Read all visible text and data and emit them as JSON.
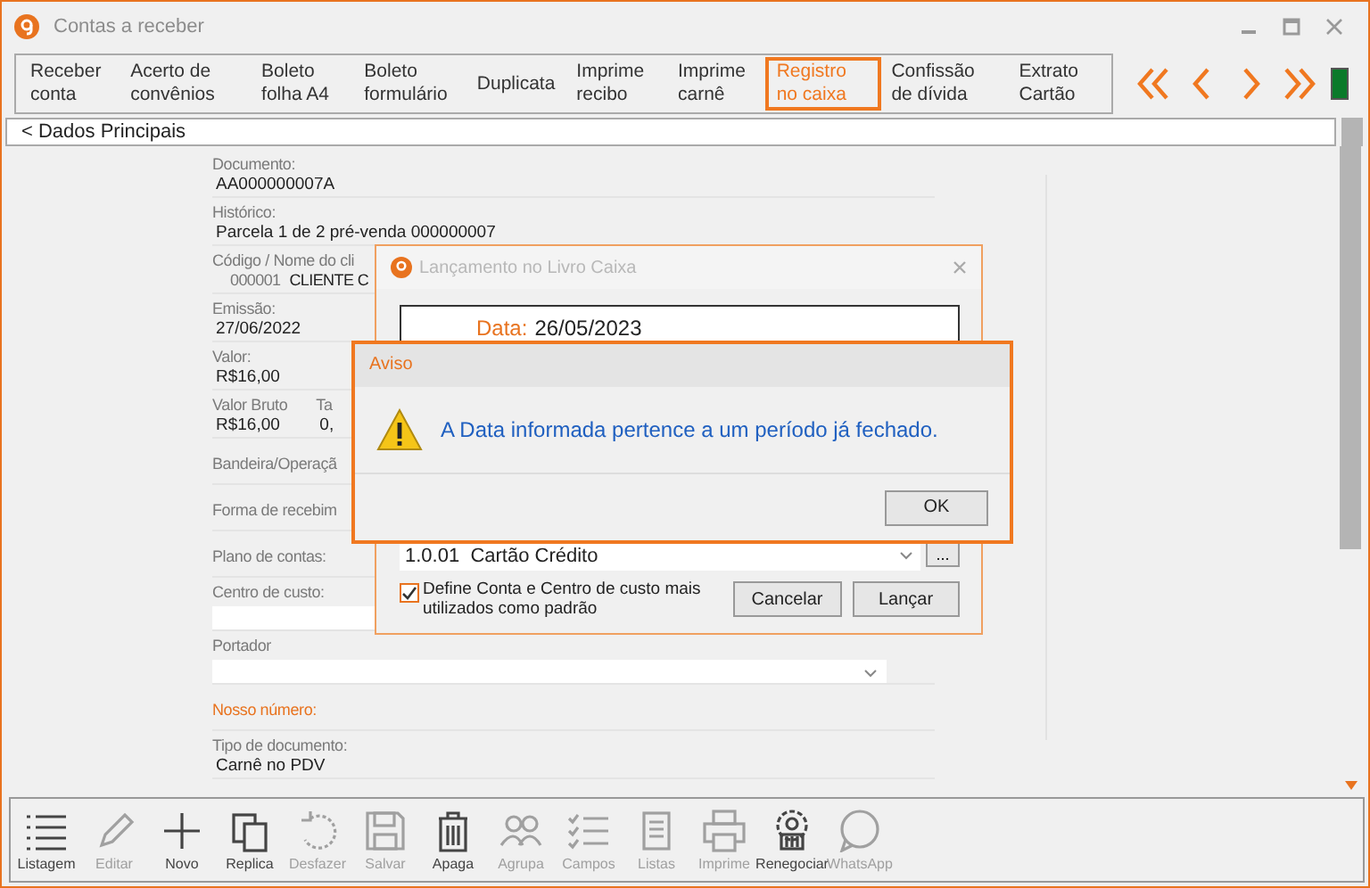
{
  "window": {
    "title": "Contas a receber"
  },
  "tabs": [
    {
      "label": "Receber conta",
      "selected": false
    },
    {
      "label": "Acerto de convênios",
      "selected": false
    },
    {
      "label": "Boleto folha A4",
      "selected": false
    },
    {
      "label": "Boleto formulário",
      "selected": false
    },
    {
      "label": "Duplicata",
      "selected": false
    },
    {
      "label": "Imprime recibo",
      "selected": false
    },
    {
      "label": "Imprime carnê",
      "selected": false
    },
    {
      "label": "Registro no caixa",
      "selected": true
    },
    {
      "label": "Confissão de dívida",
      "selected": false
    },
    {
      "label": "Extrato Cartão",
      "selected": false
    }
  ],
  "breadcrumb": "< Dados Principais",
  "fields": [
    {
      "kind": "text",
      "label": "Documento:",
      "value": "AA000000007A"
    },
    {
      "kind": "text",
      "label": "Histórico:",
      "value": "Parcela 1 de 2 pré-venda 000000007"
    },
    {
      "kind": "client",
      "label": "Código / Nome do cli",
      "code": "000001",
      "name": "CLIENTE C"
    },
    {
      "kind": "text",
      "label": "Emissão:",
      "value": "27/06/2022"
    },
    {
      "kind": "text",
      "label": "Valor:",
      "value": "R$16,00"
    },
    {
      "kind": "pair",
      "label": "Valor Bruto",
      "value": "R$16,00",
      "label_2": "Ta",
      "value_2": "0,"
    },
    {
      "kind": "label",
      "label": "Bandeira/Operaçã",
      "highlight": false
    },
    {
      "kind": "label",
      "label": "Forma de recebim",
      "highlight": false
    },
    {
      "kind": "label",
      "label": "Plano de contas:",
      "highlight": false
    },
    {
      "kind": "select",
      "label": "Centro de custo:"
    },
    {
      "kind": "select",
      "label": "Portador"
    },
    {
      "kind": "label",
      "label": "Nosso número:",
      "highlight": true
    },
    {
      "kind": "text",
      "label": "Tipo de documento:",
      "value": "Carnê no PDV"
    }
  ],
  "cash_dialog": {
    "title": "Lançamento no Livro Caixa",
    "date_label": "Data:",
    "date_value": "26/05/2023",
    "account": "1.0.01  Cartão Crédito",
    "browse_button": "...",
    "default_checkbox": {
      "label": "Define Conta e Centro de custo mais utilizados como padrão",
      "checked": true
    },
    "buttons": [
      "Cancelar",
      "Lançar"
    ]
  },
  "alert": {
    "title": "Aviso",
    "message": "A Data informada pertence a um período já fechado.",
    "button": "OK"
  },
  "toolbar": [
    {
      "kind": "list",
      "label": "Listagem",
      "disabled": false
    },
    {
      "kind": "pencil",
      "label": "Editar",
      "disabled": true
    },
    {
      "kind": "plus",
      "label": "Novo",
      "disabled": false
    },
    {
      "kind": "copy",
      "label": "Replica",
      "disabled": false
    },
    {
      "kind": "undo",
      "label": "Desfazer",
      "disabled": true
    },
    {
      "kind": "save",
      "label": "Salvar",
      "disabled": true
    },
    {
      "kind": "trash",
      "label": "Apaga",
      "disabled": false
    },
    {
      "kind": "people",
      "label": "Agrupa",
      "disabled": true
    },
    {
      "kind": "checklist",
      "label": "Campos",
      "disabled": true
    },
    {
      "kind": "sheet",
      "label": "Listas",
      "disabled": true
    },
    {
      "kind": "printer",
      "label": "Imprime",
      "disabled": true
    },
    {
      "kind": "coin",
      "label": "Renegociar",
      "disabled": false
    },
    {
      "kind": "chat",
      "label": "WhatsApp",
      "disabled": true
    }
  ]
}
